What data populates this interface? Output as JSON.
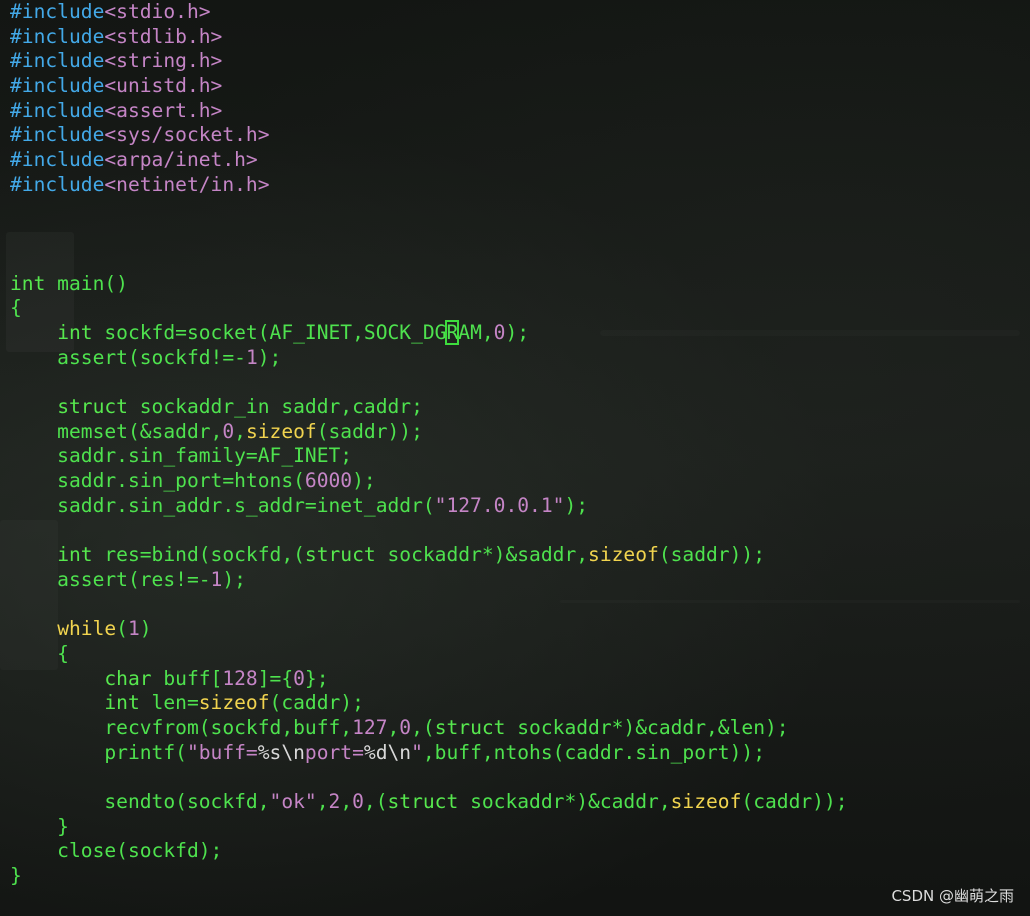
{
  "editor": {
    "lines": [
      [
        {
          "t": "#include",
          "c": "pp"
        },
        {
          "t": "<stdio.h>",
          "c": "hdr"
        }
      ],
      [
        {
          "t": "#include",
          "c": "pp"
        },
        {
          "t": "<stdlib.h>",
          "c": "hdr"
        }
      ],
      [
        {
          "t": "#include",
          "c": "pp"
        },
        {
          "t": "<string.h>",
          "c": "hdr"
        }
      ],
      [
        {
          "t": "#include",
          "c": "pp"
        },
        {
          "t": "<unistd.h>",
          "c": "hdr"
        }
      ],
      [
        {
          "t": "#include",
          "c": "pp"
        },
        {
          "t": "<assert.h>",
          "c": "hdr"
        }
      ],
      [
        {
          "t": "#include",
          "c": "pp"
        },
        {
          "t": "<sys/socket.h>",
          "c": "hdr"
        }
      ],
      [
        {
          "t": "#include",
          "c": "pp"
        },
        {
          "t": "<arpa/inet.h>",
          "c": "hdr"
        }
      ],
      [
        {
          "t": "#include",
          "c": "pp"
        },
        {
          "t": "<netinet/in.h>",
          "c": "hdr"
        }
      ],
      [],
      [],
      [],
      [
        {
          "t": "int",
          "c": "ty"
        },
        {
          "t": " main()",
          "c": "plain"
        }
      ],
      [
        {
          "t": "{",
          "c": "plain"
        }
      ],
      [
        {
          "t": "    ",
          "c": "plain"
        },
        {
          "t": "int",
          "c": "ty"
        },
        {
          "t": " sockfd=socket(AF_INET,SOCK_DG",
          "c": "plain"
        },
        {
          "t": "R",
          "c": "plain",
          "cursor": true
        },
        {
          "t": "AM,",
          "c": "plain"
        },
        {
          "t": "0",
          "c": "num"
        },
        {
          "t": ");",
          "c": "plain"
        }
      ],
      [
        {
          "t": "    assert(sockfd!=-",
          "c": "plain"
        },
        {
          "t": "1",
          "c": "num"
        },
        {
          "t": ");",
          "c": "plain"
        }
      ],
      [],
      [
        {
          "t": "    ",
          "c": "plain"
        },
        {
          "t": "struct",
          "c": "ty"
        },
        {
          "t": " sockaddr_in saddr,caddr;",
          "c": "plain"
        }
      ],
      [
        {
          "t": "    memset(&saddr,",
          "c": "plain"
        },
        {
          "t": "0",
          "c": "num"
        },
        {
          "t": ",",
          "c": "plain"
        },
        {
          "t": "sizeof",
          "c": "kw"
        },
        {
          "t": "(saddr));",
          "c": "plain"
        }
      ],
      [
        {
          "t": "    saddr.sin_family=AF_INET;",
          "c": "plain"
        }
      ],
      [
        {
          "t": "    saddr.sin_port=htons(",
          "c": "plain"
        },
        {
          "t": "6000",
          "c": "num"
        },
        {
          "t": ");",
          "c": "plain"
        }
      ],
      [
        {
          "t": "    saddr.sin_addr.s_addr=inet_addr(",
          "c": "plain"
        },
        {
          "t": "\"127.0.0.1\"",
          "c": "str"
        },
        {
          "t": ");",
          "c": "plain"
        }
      ],
      [],
      [
        {
          "t": "    ",
          "c": "plain"
        },
        {
          "t": "int",
          "c": "ty"
        },
        {
          "t": " res=bind(sockfd,(",
          "c": "plain"
        },
        {
          "t": "struct",
          "c": "ty"
        },
        {
          "t": " sockaddr*)&saddr,",
          "c": "plain"
        },
        {
          "t": "sizeof",
          "c": "kw"
        },
        {
          "t": "(saddr));",
          "c": "plain"
        }
      ],
      [
        {
          "t": "    assert(res!=-",
          "c": "plain"
        },
        {
          "t": "1",
          "c": "num"
        },
        {
          "t": ");",
          "c": "plain"
        }
      ],
      [],
      [
        {
          "t": "    ",
          "c": "plain"
        },
        {
          "t": "while",
          "c": "kw"
        },
        {
          "t": "(",
          "c": "plain"
        },
        {
          "t": "1",
          "c": "num"
        },
        {
          "t": ")",
          "c": "plain"
        }
      ],
      [
        {
          "t": "    {",
          "c": "plain"
        }
      ],
      [
        {
          "t": "        ",
          "c": "plain"
        },
        {
          "t": "char",
          "c": "ty"
        },
        {
          "t": " buff[",
          "c": "plain"
        },
        {
          "t": "128",
          "c": "num"
        },
        {
          "t": "]={",
          "c": "plain"
        },
        {
          "t": "0",
          "c": "num"
        },
        {
          "t": "};",
          "c": "plain"
        }
      ],
      [
        {
          "t": "        ",
          "c": "plain"
        },
        {
          "t": "int",
          "c": "ty"
        },
        {
          "t": " len=",
          "c": "plain"
        },
        {
          "t": "sizeof",
          "c": "kw"
        },
        {
          "t": "(caddr);",
          "c": "plain"
        }
      ],
      [
        {
          "t": "        recvfrom(sockfd,buff,",
          "c": "plain"
        },
        {
          "t": "127",
          "c": "num"
        },
        {
          "t": ",",
          "c": "plain"
        },
        {
          "t": "0",
          "c": "num"
        },
        {
          "t": ",(",
          "c": "plain"
        },
        {
          "t": "struct",
          "c": "ty"
        },
        {
          "t": " sockaddr*)&caddr,&len);",
          "c": "plain"
        }
      ],
      [
        {
          "t": "        printf(",
          "c": "plain"
        },
        {
          "t": "\"buff=",
          "c": "str"
        },
        {
          "t": "%s\\n",
          "c": "esc"
        },
        {
          "t": "port=",
          "c": "str"
        },
        {
          "t": "%d\\n",
          "c": "esc"
        },
        {
          "t": "\"",
          "c": "str"
        },
        {
          "t": ",buff,ntohs(caddr.sin_port));",
          "c": "plain"
        }
      ],
      [],
      [
        {
          "t": "        sendto(sockfd,",
          "c": "plain"
        },
        {
          "t": "\"ok\"",
          "c": "str"
        },
        {
          "t": ",",
          "c": "plain"
        },
        {
          "t": "2",
          "c": "num"
        },
        {
          "t": ",",
          "c": "plain"
        },
        {
          "t": "0",
          "c": "num"
        },
        {
          "t": ",(",
          "c": "plain"
        },
        {
          "t": "struct",
          "c": "ty"
        },
        {
          "t": " sockaddr*)&caddr,",
          "c": "plain"
        },
        {
          "t": "sizeof",
          "c": "kw"
        },
        {
          "t": "(caddr));",
          "c": "plain"
        }
      ],
      [
        {
          "t": "    }",
          "c": "plain"
        }
      ],
      [
        {
          "t": "    close(sockfd);",
          "c": "plain"
        }
      ],
      [
        {
          "t": "}",
          "c": "plain"
        }
      ]
    ]
  },
  "watermark": "CSDN @幽萌之雨",
  "colors": {
    "background": "#141714",
    "preprocessor": "#43a9e8",
    "header": "#c585c6",
    "type": "#57e84e",
    "keyword": "#f1d44f",
    "string": "#c585c6",
    "number": "#c585c6",
    "text": "#4ee24e",
    "cursor": "#3ddc3d"
  }
}
